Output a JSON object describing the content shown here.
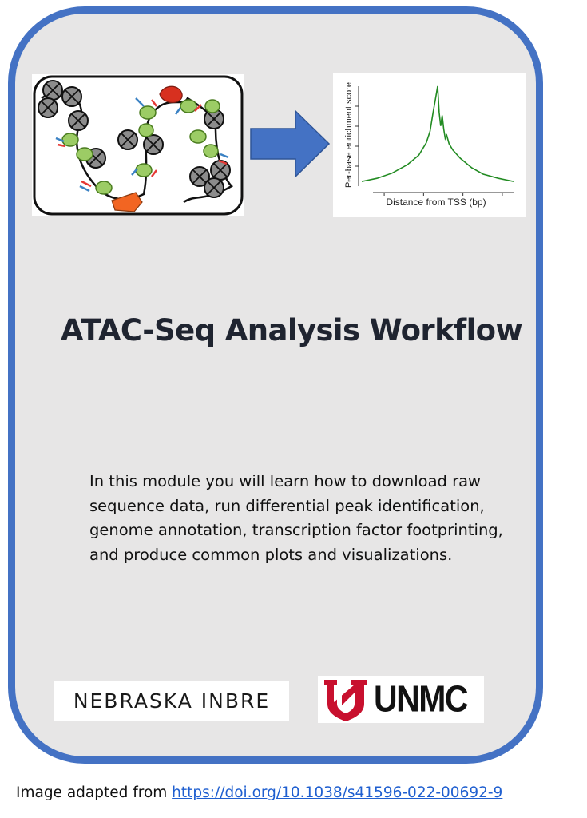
{
  "card": {
    "border_color": "#4472c4",
    "fill_color": "#e7e6e6"
  },
  "illustration": {
    "left_panel_icon": "chromatin-nucleosome-diagram",
    "arrow_icon": "right-arrow-icon",
    "arrow_color": "#4472c4"
  },
  "chart_data": {
    "type": "line",
    "title": "",
    "xlabel": "Distance from TSS (bp)",
    "ylabel": "Per-base enrichment score",
    "line_color": "#228b22",
    "xlim": [
      -100,
      100
    ],
    "ylim": [
      0,
      10
    ],
    "x": [
      -100,
      -80,
      -60,
      -40,
      -25,
      -15,
      -10,
      -6,
      -3,
      0,
      2,
      4,
      6,
      8,
      10,
      12,
      15,
      20,
      30,
      45,
      60,
      80,
      100
    ],
    "values": [
      0.6,
      0.9,
      1.4,
      2.2,
      3.1,
      4.3,
      5.4,
      7.2,
      8.4,
      9.7,
      7.2,
      5.9,
      6.9,
      5.6,
      4.7,
      5.0,
      4.2,
      3.6,
      2.8,
      1.9,
      1.3,
      0.9,
      0.6
    ]
  },
  "title": "ATAC-Seq Analysis Workflow",
  "description": "In this module you will learn how to download raw sequence data, run differential peak identification, genome annotation, transcription factor footprinting, and produce common plots and visualizations.",
  "logos": {
    "inbre": "NEBRASKA INBRE",
    "unmc": "UNMC",
    "unmc_mark_icon": "unmc-n-shield-icon",
    "unmc_mark_color": "#c8102e"
  },
  "credit": {
    "prefix": "Image adapted from ",
    "link_text": "https://doi.org/10.1038/s41596-022-00692-9"
  }
}
